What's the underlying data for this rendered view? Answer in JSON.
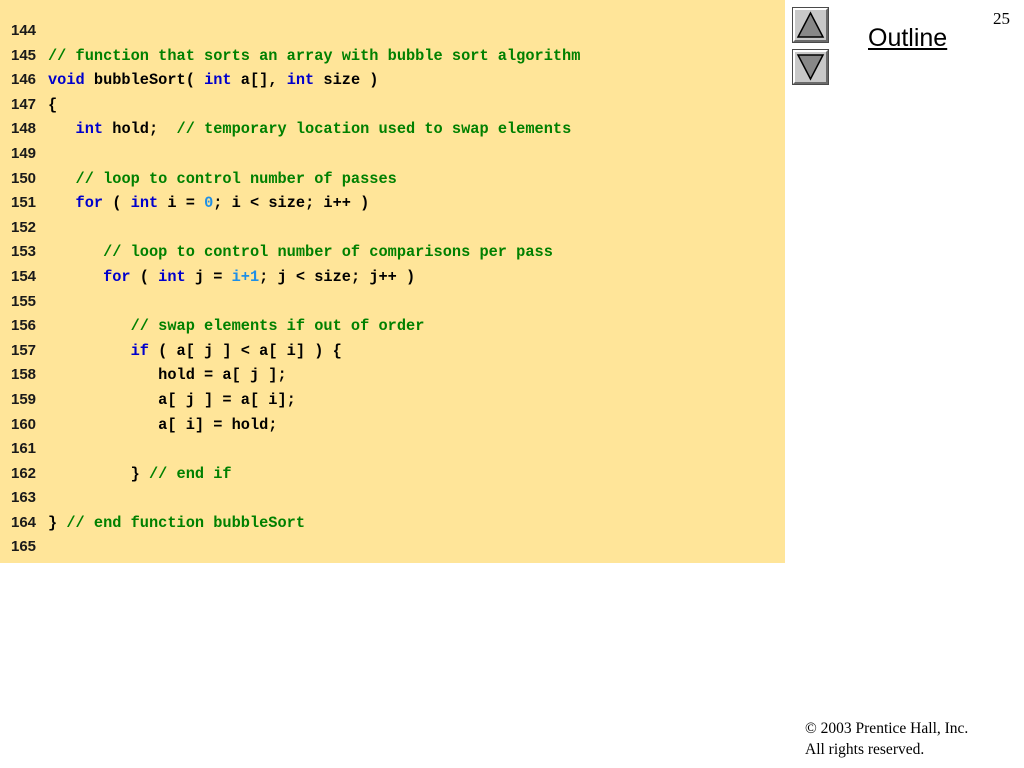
{
  "slide": {
    "number": "25",
    "outline_label": "Outline",
    "copyright_line1": "© 2003 Prentice Hall, Inc.",
    "copyright_line2": "All rights reserved."
  },
  "navigation": {
    "up_icon": "triangle-up-icon",
    "down_icon": "triangle-down-icon"
  },
  "colors": {
    "code_background": "#ffe599",
    "comment": "#008000",
    "keyword": "#0000cc",
    "literal": "#1e8fe6",
    "plain": "#000000"
  },
  "code": {
    "lines": [
      {
        "num": "144",
        "tokens": []
      },
      {
        "num": "145",
        "tokens": [
          {
            "t": "// function that sorts an array with bubble sort algorithm",
            "c": "comment"
          }
        ]
      },
      {
        "num": "146",
        "tokens": [
          {
            "t": "void",
            "c": "keyword"
          },
          {
            "t": " bubbleSort( ",
            "c": "plain"
          },
          {
            "t": "int",
            "c": "keyword"
          },
          {
            "t": " a[], ",
            "c": "plain"
          },
          {
            "t": "int",
            "c": "keyword"
          },
          {
            "t": " size )",
            "c": "plain"
          }
        ]
      },
      {
        "num": "147",
        "tokens": [
          {
            "t": "{",
            "c": "plain"
          }
        ]
      },
      {
        "num": "148",
        "tokens": [
          {
            "t": "   ",
            "c": "plain"
          },
          {
            "t": "int",
            "c": "keyword"
          },
          {
            "t": " hold;  ",
            "c": "plain"
          },
          {
            "t": "// temporary location used to swap elements",
            "c": "comment"
          }
        ]
      },
      {
        "num": "149",
        "tokens": []
      },
      {
        "num": "150",
        "tokens": [
          {
            "t": "   ",
            "c": "plain"
          },
          {
            "t": "// loop to control number of passes",
            "c": "comment"
          }
        ]
      },
      {
        "num": "151",
        "tokens": [
          {
            "t": "   ",
            "c": "plain"
          },
          {
            "t": "for",
            "c": "keyword"
          },
          {
            "t": " ( ",
            "c": "plain"
          },
          {
            "t": "int",
            "c": "keyword"
          },
          {
            "t": " i = ",
            "c": "plain"
          },
          {
            "t": "0",
            "c": "literal"
          },
          {
            "t": "; i < size; i++ )",
            "c": "plain"
          }
        ]
      },
      {
        "num": "152",
        "tokens": []
      },
      {
        "num": "153",
        "tokens": [
          {
            "t": "      ",
            "c": "plain"
          },
          {
            "t": "// loop to control number of comparisons per pass",
            "c": "comment"
          }
        ]
      },
      {
        "num": "154",
        "tokens": [
          {
            "t": "      ",
            "c": "plain"
          },
          {
            "t": "for",
            "c": "keyword"
          },
          {
            "t": " ( ",
            "c": "plain"
          },
          {
            "t": "int",
            "c": "keyword"
          },
          {
            "t": " j = ",
            "c": "plain"
          },
          {
            "t": "i+1",
            "c": "literal"
          },
          {
            "t": "; j < size; j++ )",
            "c": "plain"
          }
        ]
      },
      {
        "num": "155",
        "tokens": []
      },
      {
        "num": "156",
        "tokens": [
          {
            "t": "         ",
            "c": "plain"
          },
          {
            "t": "// swap elements if out of order",
            "c": "comment"
          }
        ]
      },
      {
        "num": "157",
        "tokens": [
          {
            "t": "         ",
            "c": "plain"
          },
          {
            "t": "if",
            "c": "keyword"
          },
          {
            "t": " ( a[ j ] < a[ i] ) {",
            "c": "plain"
          }
        ]
      },
      {
        "num": "158",
        "tokens": [
          {
            "t": "            hold = a[ j ];",
            "c": "plain"
          }
        ]
      },
      {
        "num": "159",
        "tokens": [
          {
            "t": "            a[ j ] = a[ i];",
            "c": "plain"
          }
        ]
      },
      {
        "num": "160",
        "tokens": [
          {
            "t": "            a[ i] = hold;",
            "c": "plain"
          }
        ]
      },
      {
        "num": "161",
        "tokens": []
      },
      {
        "num": "162",
        "tokens": [
          {
            "t": "         } ",
            "c": "plain"
          },
          {
            "t": "// end if",
            "c": "comment"
          }
        ]
      },
      {
        "num": "163",
        "tokens": []
      },
      {
        "num": "164",
        "tokens": [
          {
            "t": "} ",
            "c": "plain"
          },
          {
            "t": "// end function bubbleSort",
            "c": "comment"
          }
        ]
      },
      {
        "num": "165",
        "tokens": []
      }
    ]
  }
}
